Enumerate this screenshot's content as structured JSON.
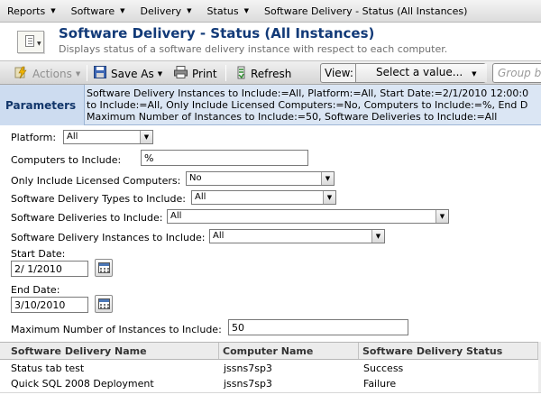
{
  "menu": {
    "reports": "Reports",
    "software": "Software",
    "delivery": "Delivery",
    "status": "Status",
    "current": "Software Delivery - Status (All Instances)"
  },
  "header": {
    "title": "Software Delivery - Status (All Instances)",
    "subtitle": "Displays status of a software delivery instance with respect to each computer."
  },
  "toolbar": {
    "actions": "Actions",
    "save_as": "Save As",
    "print": "Print",
    "refresh": "Refresh",
    "view_label": "View:",
    "view_value": "Select a value...",
    "group_by_placeholder": "Group by"
  },
  "parameters": {
    "label": "Parameters",
    "line1": "Software Delivery Instances to Include:=All, Platform:=All, Start Date:=2/1/2010 12:00:0",
    "line2": "to Include:=All, Only Include Licensed Computers:=No, Computers to Include:=%, End D",
    "line3": "Maximum Number of Instances to Include:=50, Software Deliveries to Include:=All"
  },
  "form": {
    "platform_label": "Platform:",
    "platform_value": "All",
    "computers_label": "Computers to Include:",
    "computers_value": "%",
    "licensed_label": "Only Include Licensed Computers:",
    "licensed_value": "No",
    "types_label": "Software Delivery Types to Include:",
    "types_value": "All",
    "deliveries_label": "Software Deliveries to Include:",
    "deliveries_value": "All",
    "instances_label": "Software Delivery Instances to Include:",
    "instances_value": "All",
    "start_label": "Start Date:",
    "start_value": "2/ 1/2010",
    "end_label": "End Date:",
    "end_value": "3/10/2010",
    "max_label": "Maximum Number of Instances to Include:",
    "max_value": "50"
  },
  "table": {
    "columns": [
      "Software Delivery Name",
      "Computer Name",
      "Software Delivery Status"
    ],
    "rows": [
      [
        "Status tab test",
        "jssns7sp3",
        "Success"
      ],
      [
        "Quick SQL 2008 Deployment",
        "jssns7sp3",
        "Failure"
      ]
    ]
  },
  "icons": {
    "header": "report-document-icon",
    "actions": "actions-lightning-icon",
    "save": "floppy-disk-icon",
    "print": "printer-icon",
    "refresh": "refresh-icon",
    "calendar": "calendar-icon"
  }
}
